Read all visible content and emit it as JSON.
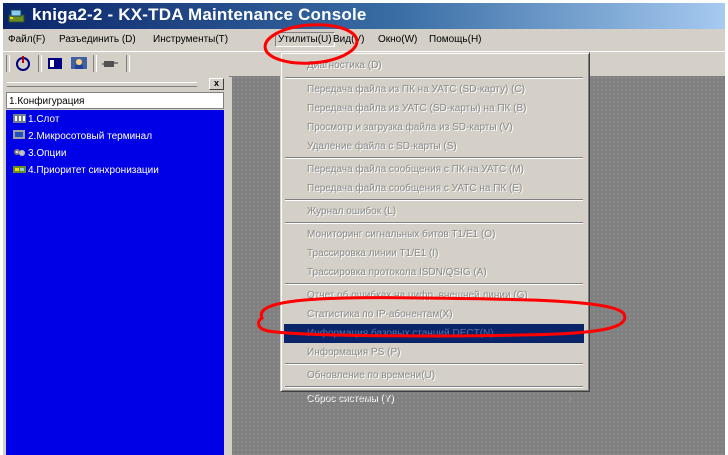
{
  "window": {
    "title": "kniga2-2 - KX-TDA Maintenance Console"
  },
  "menubar": {
    "items": [
      {
        "label": "Файл(F)"
      },
      {
        "label": "Разъединить (D)"
      },
      {
        "label": "Инструменты(T)"
      },
      {
        "label": "Утилиты(U)"
      },
      {
        "label": "Вид(V)"
      },
      {
        "label": "Окно(W)"
      },
      {
        "label": "Помощь(H)"
      }
    ]
  },
  "toolbar": {
    "icons": [
      "connect-icon",
      "panel-icon",
      "user-icon",
      "plug-icon"
    ]
  },
  "tree": {
    "title": "1.Конфигурация",
    "close_label": "x",
    "items": [
      {
        "label": "1.Слот",
        "icon": "slot-icon"
      },
      {
        "label": "2.Микросотовый терминал",
        "icon": "terminal-icon"
      },
      {
        "label": "3.Опции",
        "icon": "options-icon"
      },
      {
        "label": "4.Приоритет синхронизации",
        "icon": "sync-icon"
      }
    ]
  },
  "utilities_menu": {
    "items": [
      {
        "label": "Диагностика (D)"
      },
      {
        "label": "Передача файла из ПК на УАТС (SD-карту) (C)"
      },
      {
        "label": "Передача файла из УАТС (SD-карты) на ПК (B)"
      },
      {
        "label": "Просмотр и загрузка файла из SD-карты (V)"
      },
      {
        "label": "Удаление файла с SD-карты (S)"
      },
      {
        "label": "Передача файла сообщения с ПК на УАТС (M)"
      },
      {
        "label": "Передача файла сообщения с УАТС на ПК (E)"
      },
      {
        "label": "Журнал ошибок (L)"
      },
      {
        "label": "Мониторинг сигнальных битов T1/E1 (O)"
      },
      {
        "label": "Трассировка линии T1/E1 (I)"
      },
      {
        "label": "Трассировка протокола ISDN/QSIG (A)"
      },
      {
        "label": "Отчет об ошибках на цифр. внешней линии (G)"
      },
      {
        "label": "Статистика по IP-абонентам(X)"
      },
      {
        "label": "Информация базовых станций DECT(N)",
        "highlighted": true
      },
      {
        "label": "Информация PS (P)"
      },
      {
        "label": "Обновление по времени(U)"
      },
      {
        "label": "Сброс системы (Y)",
        "submenu": true
      }
    ]
  },
  "colors": {
    "title_gradient_start": "#0a246a",
    "tree_background": "#0000e6",
    "highlight": "#0a246a",
    "annotation": "#ff0000"
  }
}
